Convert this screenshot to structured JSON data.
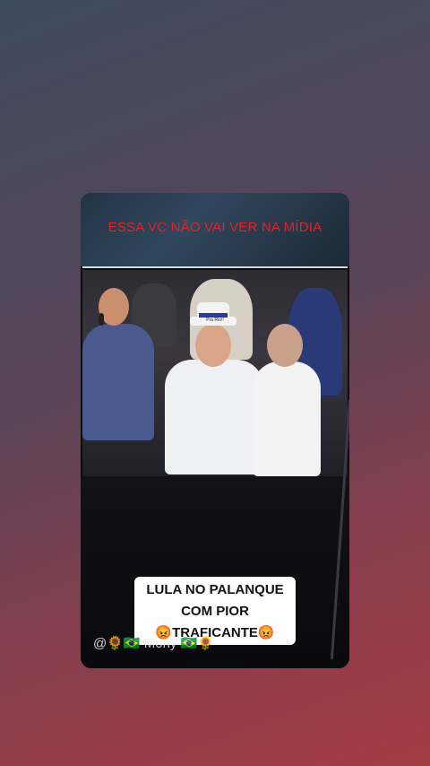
{
  "story": {
    "headline": "ESSA VC NÃO VAI VER NA MÍDIA",
    "caption_line1": "LULA NO PALANQUE",
    "caption_line2": "COM PIOR",
    "caption_line3": "😡TRAFICANTE😡",
    "username": "@🌻🇧🇷 Mony 🇧🇷🌻",
    "hat_text": "Pra Rio!!"
  },
  "colors": {
    "headline": "#e0242a",
    "background_top": "#3e4a5e",
    "background_bottom": "#a23a42"
  }
}
